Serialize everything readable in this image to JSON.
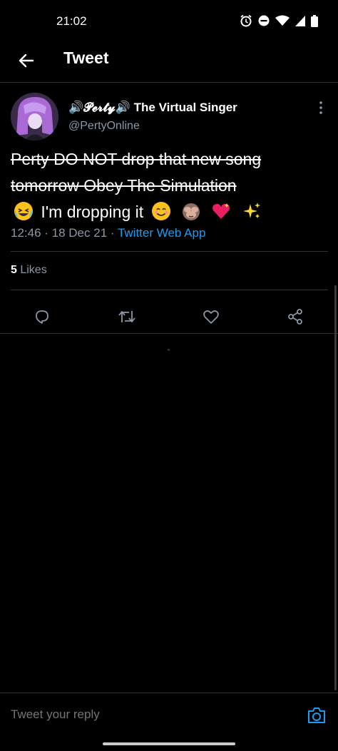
{
  "status": {
    "time": "21:02"
  },
  "header": {
    "title": "Tweet"
  },
  "tweet": {
    "display_name": "🔊𝓟𝓮𝓻𝓽𝔂🔊 The Virtual Singer",
    "handle": "@PertyOnline",
    "struck_text": "Perty DO NOT drop that new song tomorrow Obey The Simulation",
    "text_after": " I'm dropping it",
    "timestamp": "12:46 · 18 Dec 21 · ",
    "source": "Twitter Web App",
    "likes_count": "5",
    "likes_label": " Likes"
  },
  "reply": {
    "placeholder": "Tweet your reply"
  },
  "icons": {
    "back": "arrow-left-icon",
    "more": "more-vertical-icon",
    "reply": "reply-icon",
    "retweet": "retweet-icon",
    "like": "heart-icon",
    "share": "share-icon",
    "camera": "camera-icon"
  },
  "colors": {
    "background": "#000000",
    "link": "#1d9bf0",
    "muted": "#8b98a5"
  }
}
